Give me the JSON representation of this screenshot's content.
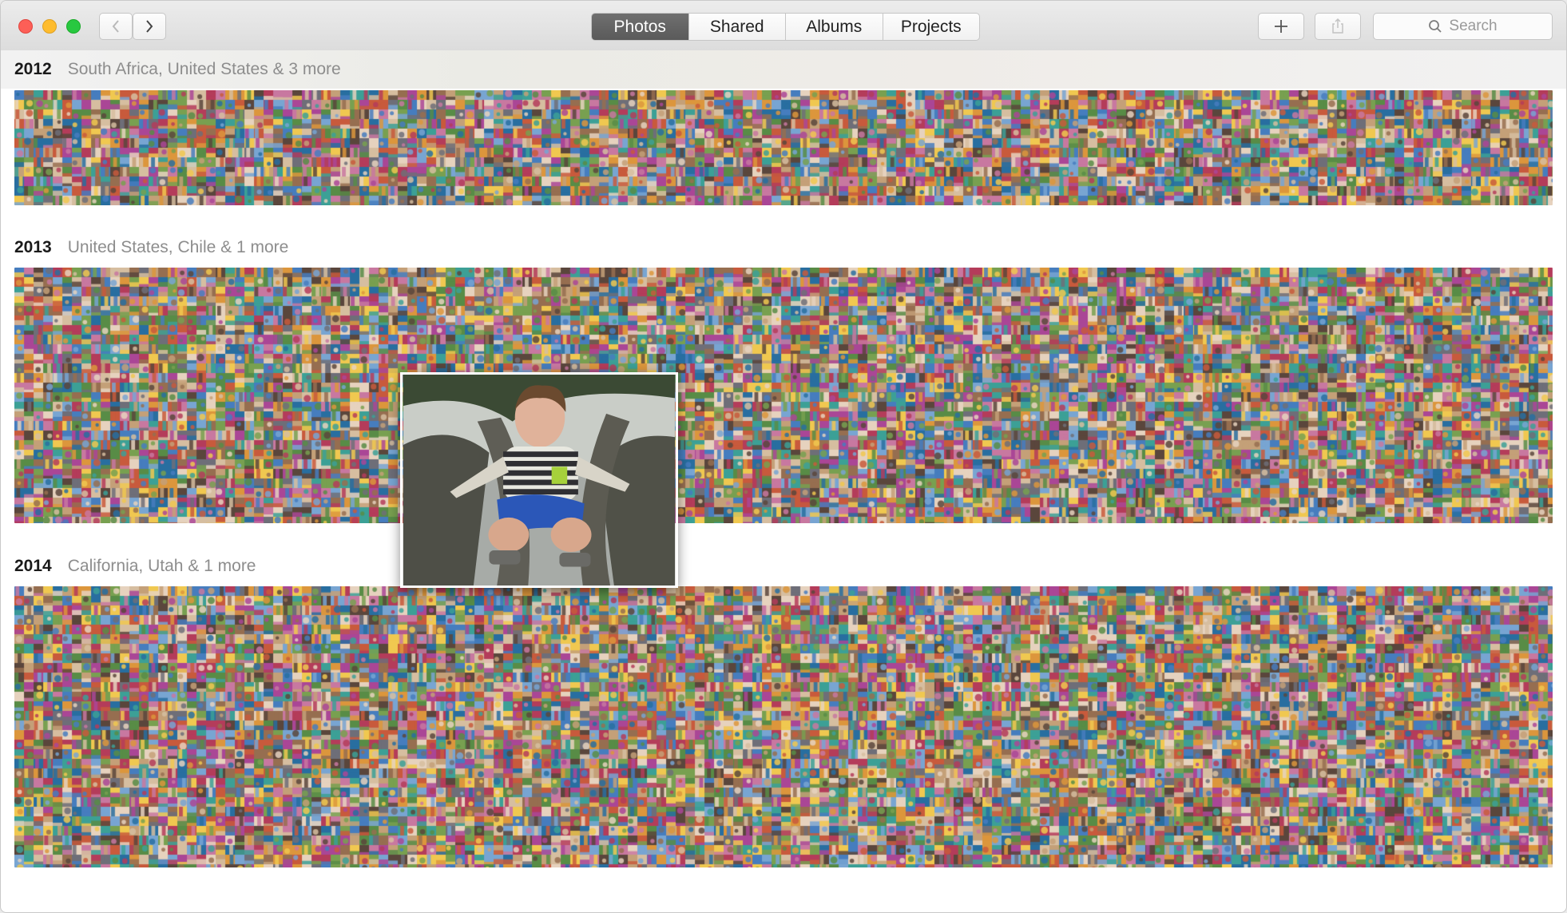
{
  "toolbar": {
    "tabs": [
      {
        "label": "Photos",
        "active": true
      },
      {
        "label": "Shared",
        "active": false
      },
      {
        "label": "Albums",
        "active": false
      },
      {
        "label": "Projects",
        "active": false
      }
    ],
    "search_placeholder": "Search",
    "icons": {
      "back": "chevron-left-icon",
      "forward": "chevron-right-icon",
      "add": "plus-icon",
      "share": "share-icon",
      "search": "magnifier-icon"
    }
  },
  "years": [
    {
      "year": "2012",
      "locations": "South Africa, United States & 3 more"
    },
    {
      "year": "2013",
      "locations": "United States, Chile & 1 more"
    },
    {
      "year": "2014",
      "locations": "California, Utah & 1 more"
    }
  ],
  "colors": {
    "close": "#fd5f57",
    "minimize": "#febc2e",
    "zoom": "#28c840",
    "active_tab": "#636363"
  }
}
